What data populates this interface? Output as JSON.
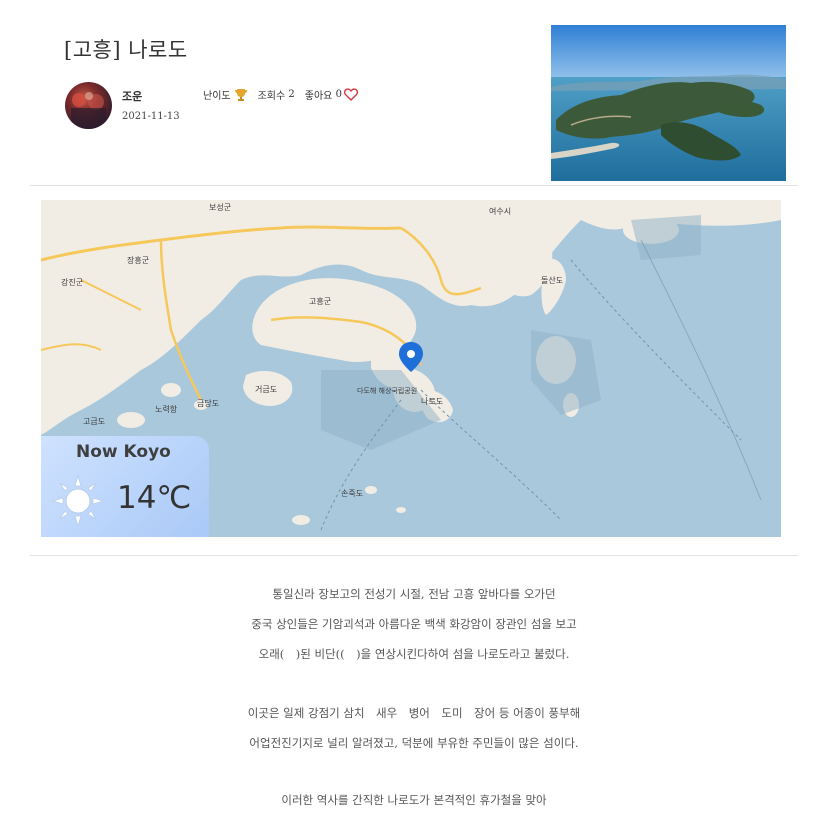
{
  "post": {
    "title": "[고흥] 나로도",
    "author": "조운",
    "date": "2021-11-13",
    "difficulty_label": "난이도",
    "views_label": "조회수",
    "views_count": "2",
    "likes_label": "좋아요",
    "likes_count": "0"
  },
  "map": {
    "place_labels": [
      "보성군",
      "여수시",
      "장흥군",
      "강진군",
      "고흥군",
      "거금도",
      "나로도",
      "다도해 해상국립공원",
      "금당도",
      "노력항",
      "고금도",
      "돌산도",
      "손죽도"
    ]
  },
  "weather": {
    "title": "Now Koyo",
    "temperature": "14℃",
    "icon": "sun-icon"
  },
  "article": {
    "paragraph1": [
      "통일신라 장보고의 전성기 시절, 전남 고흥 앞바다를 오가던",
      "중국 상인들은 기암괴석과 아름다운 백색 화강암이 장관인 섬을 보고",
      "오래(　)된 비단((　)을 연상시킨다하여 섬을 나로도라고 불렀다."
    ],
    "paragraph2": [
      "이곳은 일제 강점기 삼치　새우　병어　도미　장어 등 어종이 풍부해",
      "어업전진기지로 널리 알려졌고, 덕분에 부유한 주민들이 많은 섬이다."
    ],
    "paragraph3": [
      "이러한 역사를 간직한 나로도가 본격적인 휴가철을 맞아"
    ]
  },
  "colors": {
    "sea": "#a9c8dc",
    "land": "#f1ede4",
    "road": "#f6c85b",
    "pin": "#1e6fd9",
    "heart": "#d9363e"
  }
}
